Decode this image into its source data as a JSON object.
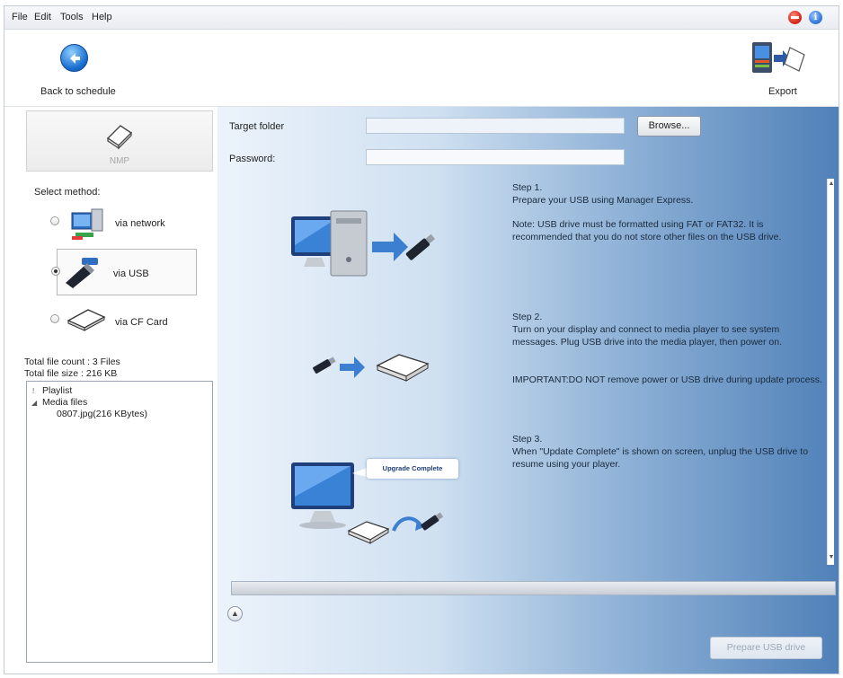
{
  "menu": {
    "file": "File",
    "edit": "Edit",
    "tools": "Tools",
    "help": "Help"
  },
  "toolbar": {
    "back_label": "Back to schedule",
    "export_label": "Export"
  },
  "left": {
    "device_label": "NMP",
    "select_method": "Select method:",
    "methods": [
      {
        "label": "via network",
        "selected": false
      },
      {
        "label": "via USB",
        "selected": true
      },
      {
        "label": "via CF Card",
        "selected": false
      }
    ],
    "total_file_count": "Total file count : 3 Files",
    "total_file_size": "Total file size : 216 KB",
    "tree": {
      "playlist": "Playlist",
      "media_files": "Media files",
      "file": "0807.jpg(216 KBytes)"
    }
  },
  "form": {
    "target_folder_label": "Target folder",
    "target_folder_value": "",
    "password_label": "Password:",
    "password_value": "",
    "browse_label": "Browse..."
  },
  "steps": {
    "step1_title": "Step 1.",
    "step1_text": "Prepare your USB using Manager Express.",
    "step1_note": "Note: USB drive must be formatted using FAT or FAT32. It is recommended that you do not store other files on the USB drive.",
    "step2_title": "Step 2.",
    "step2_text": "Turn on your display and connect to media player to see system messages. Plug USB drive into the media player, then power on.",
    "step2_important": "IMPORTANT:DO NOT remove power or USB drive during update process.",
    "step3_title": "Step 3.",
    "step3_text": "When \"Update Complete\" is shown on screen, unplug the USB drive to resume using your player.",
    "bubble_text": "Upgrade Complete"
  },
  "footer": {
    "prepare_label": "Prepare USB drive",
    "progress": 0
  }
}
